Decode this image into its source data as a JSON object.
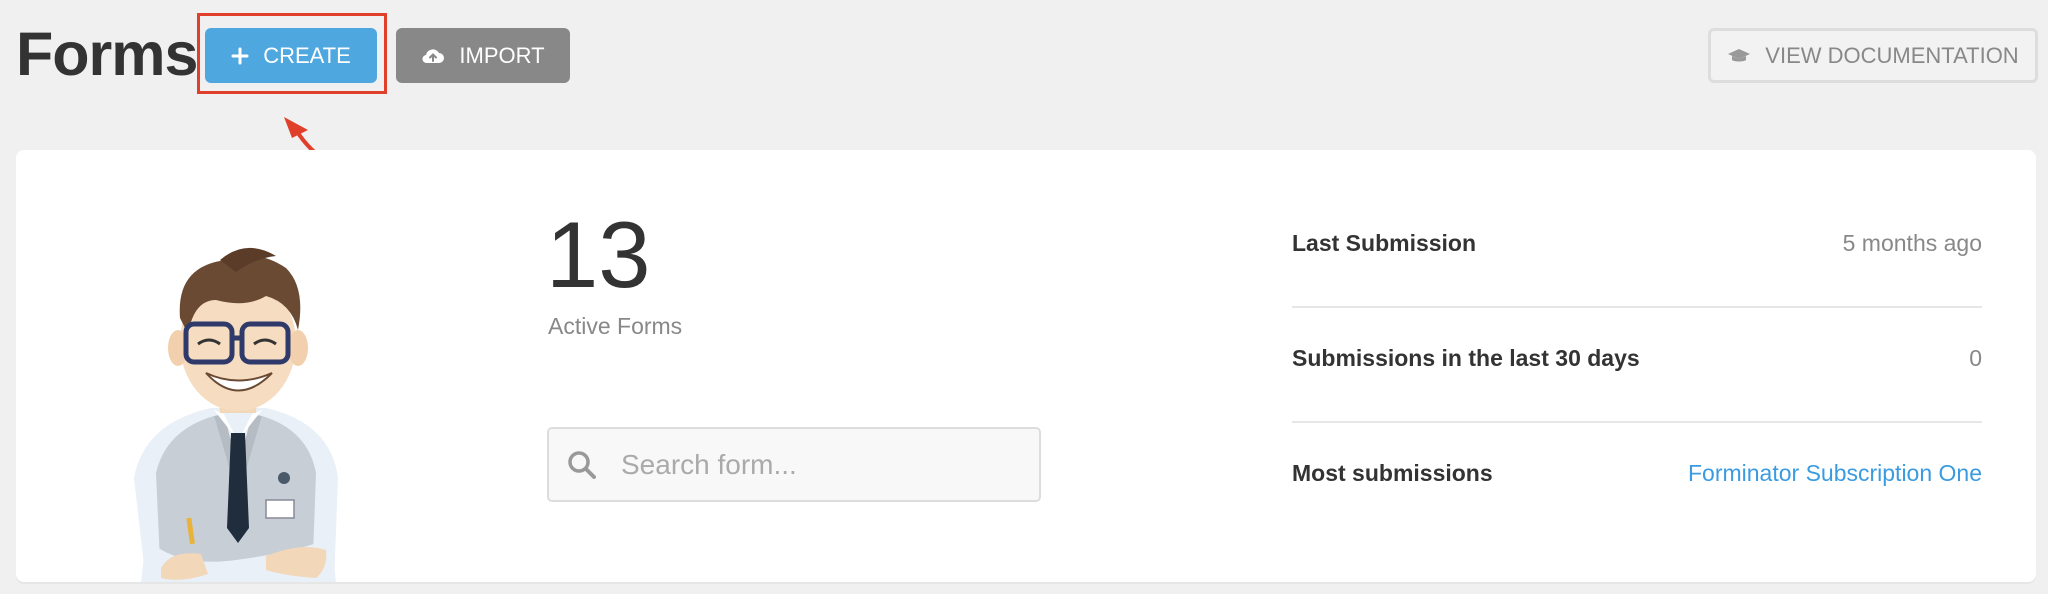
{
  "header": {
    "title": "Forms",
    "create_label": "CREATE",
    "import_label": "IMPORT",
    "docs_label": "VIEW DOCUMENTATION"
  },
  "icons": {
    "create": "plus-icon",
    "import": "cloud-upload-icon",
    "docs": "graduation-cap-icon",
    "search": "search-icon"
  },
  "stats": {
    "count": "13",
    "count_label": "Active Forms"
  },
  "search": {
    "placeholder": "Search form..."
  },
  "summary": {
    "rows": [
      {
        "label": "Last Submission",
        "value": "5 months ago"
      },
      {
        "label": "Submissions in the last 30 days",
        "value": "0"
      },
      {
        "label": "Most submissions",
        "value": "Forminator Subscription One"
      }
    ]
  },
  "colors": {
    "primary": "#4fa7e0",
    "secondary": "#888888",
    "highlight": "#e0402b",
    "link": "#3b9be0"
  }
}
